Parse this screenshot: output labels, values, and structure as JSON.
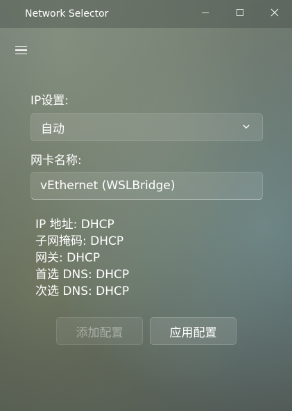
{
  "window": {
    "title": "Network Selector"
  },
  "ip_settings": {
    "label": "IP设置:",
    "selected": "自动"
  },
  "adapter": {
    "label": "网卡名称:",
    "value": "vEthernet (WSLBridge)"
  },
  "info": {
    "ip_address": "IP 地址: DHCP",
    "subnet_mask": "子网掩码: DHCP",
    "gateway": "网关: DHCP",
    "primary_dns": "首选 DNS: DHCP",
    "secondary_dns": "次选 DNS: DHCP"
  },
  "buttons": {
    "add_config": "添加配置",
    "apply_config": "应用配置"
  },
  "icons": {
    "menu": "hamburger-menu-icon",
    "dropdown": "chevron-down-icon",
    "minimize": "minimize-icon",
    "maximize": "maximize-icon",
    "close": "close-icon"
  }
}
